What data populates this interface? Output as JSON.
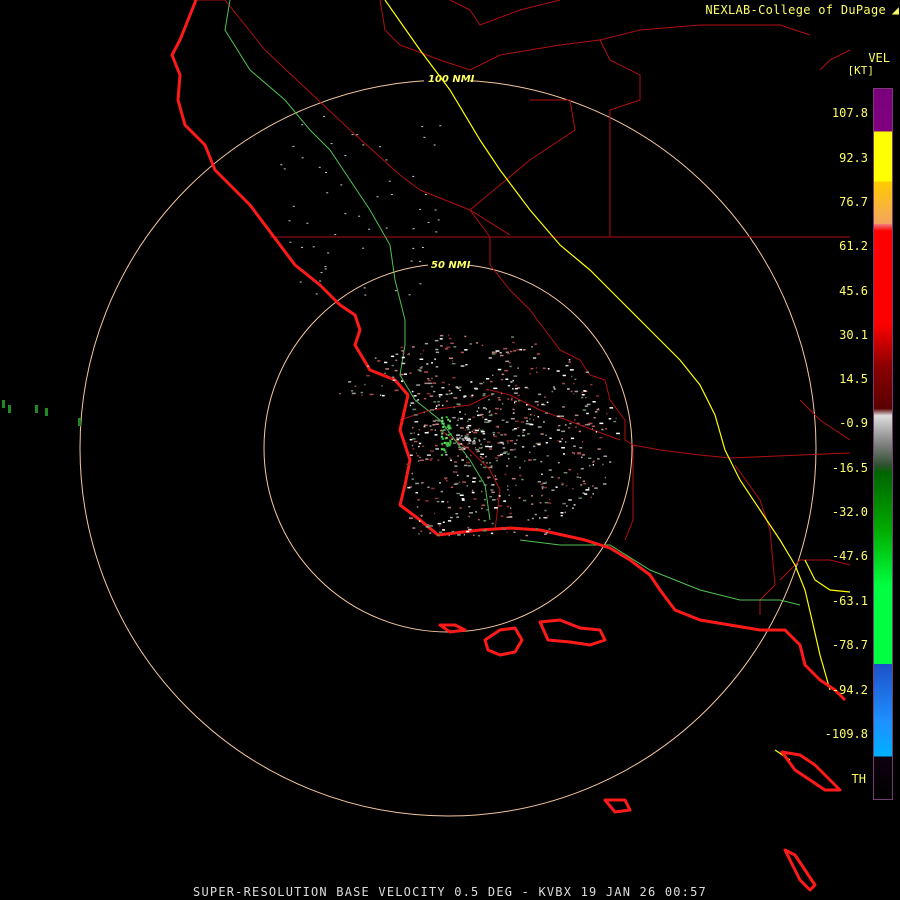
{
  "credit": "NEXLAB-College of DuPage",
  "credit_icon": "corner-logo-icon",
  "footer": "SUPER-RESOLUTION BASE VELOCITY 0.5 DEG - KVBX 19 JAN 26 00:57",
  "scale": {
    "title": "VEL",
    "unit": "[KT]",
    "ticks": [
      "107.8",
      "92.3",
      "76.7",
      "61.2",
      "45.6",
      "30.1",
      "14.5",
      "-0.9",
      "-16.5",
      "-32.0",
      "-47.6",
      "-63.1",
      "-78.7",
      "-94.2",
      "-109.8",
      "TH"
    ]
  },
  "rings": [
    "100 NMI",
    "50 NMI"
  ],
  "colors": {
    "coast": "#ff1a1a",
    "ring": "#f5c8a0",
    "county": "#b01010",
    "interstate": "#ffff00",
    "highway": "#50c050",
    "label": "#ffff66"
  }
}
